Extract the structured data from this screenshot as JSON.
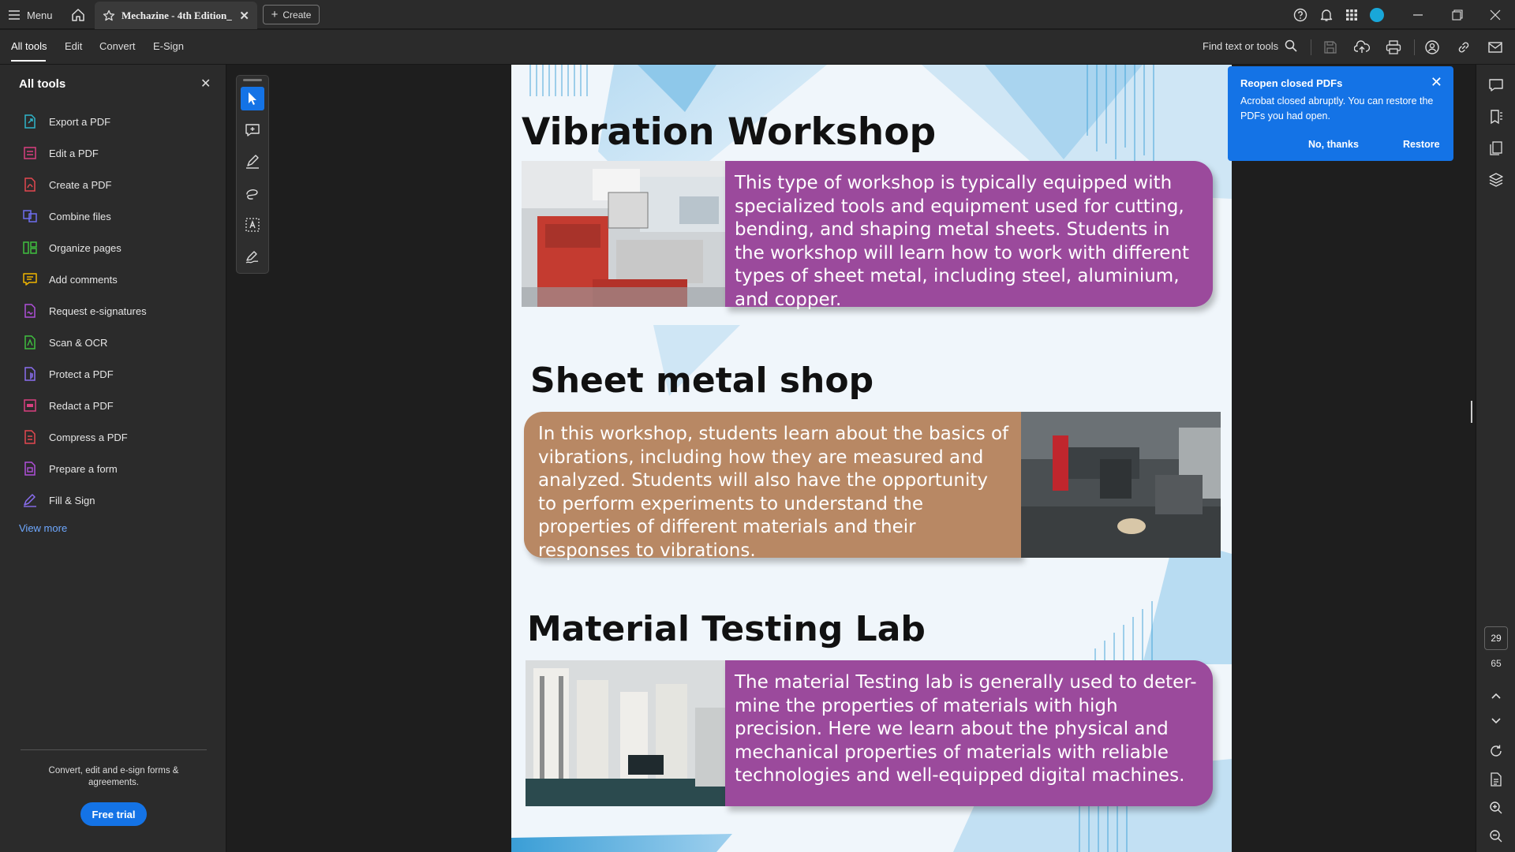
{
  "titlebar": {
    "menu_label": "Menu",
    "tab_title": "Mechazine - 4th Edition_",
    "create_label": "Create"
  },
  "toolbar": {
    "tabs": [
      "All tools",
      "Edit",
      "Convert",
      "E-Sign"
    ],
    "find_label": "Find text or tools"
  },
  "left_panel": {
    "title": "All tools",
    "items": [
      {
        "label": "Export a PDF",
        "icon": "export-pdf-icon",
        "color": "#2fb5c9"
      },
      {
        "label": "Edit a PDF",
        "icon": "edit-pdf-icon",
        "color": "#d9407f"
      },
      {
        "label": "Create a PDF",
        "icon": "create-pdf-icon",
        "color": "#e34850"
      },
      {
        "label": "Combine files",
        "icon": "combine-files-icon",
        "color": "#6e6ef0"
      },
      {
        "label": "Organize pages",
        "icon": "organize-pages-icon",
        "color": "#3fbf3f"
      },
      {
        "label": "Add comments",
        "icon": "add-comments-icon",
        "color": "#f0b400"
      },
      {
        "label": "Request e-signatures",
        "icon": "request-esign-icon",
        "color": "#b04fd9"
      },
      {
        "label": "Scan & OCR",
        "icon": "scan-ocr-icon",
        "color": "#3fbf3f"
      },
      {
        "label": "Protect a PDF",
        "icon": "protect-pdf-icon",
        "color": "#8a6ef0"
      },
      {
        "label": "Redact a PDF",
        "icon": "redact-pdf-icon",
        "color": "#d9407f"
      },
      {
        "label": "Compress a PDF",
        "icon": "compress-pdf-icon",
        "color": "#e34850"
      },
      {
        "label": "Prepare a form",
        "icon": "prepare-form-icon",
        "color": "#b04fd9"
      },
      {
        "label": "Fill & Sign",
        "icon": "fill-sign-icon",
        "color": "#8a6ef0"
      }
    ],
    "view_more": "View more",
    "promo": "Convert, edit and e-sign forms & agreements.",
    "free_trial": "Free trial"
  },
  "notification": {
    "title": "Reopen closed PDFs",
    "body": "Acrobat closed abruptly. You can restore the PDFs you had open.",
    "no_thanks": "No, thanks",
    "restore": "Restore"
  },
  "document": {
    "sections": [
      {
        "heading": "Vibration Workshop",
        "text": "This type of workshop is typically equipped with specialized tools and equipment used for cutting, bending, and shaping metal sheets. Students in the workshop will learn how to work with different types of sheet metal, including steel, aluminium, and copper.",
        "card_color": "#9b4a9c"
      },
      {
        "heading": "Sheet metal shop",
        "text": "In this workshop, students learn about the basics of vibrations, including how they are measured and analyzed. Students will also have the opportunity to perform experiments to understand the properties of different materials and their responses to vibrations.",
        "card_color": "#b88864"
      },
      {
        "heading": "Material Testing Lab",
        "text": "The material Testing lab is generally used to deter-mine the properties of materials with high precision. Here we learn about the physical and mechanical properties of materials with reliable technologies and well-equipped digital machines.",
        "card_color": "#9b4a9c"
      }
    ]
  },
  "page_nav": {
    "current": "29",
    "total": "65"
  },
  "colors": {
    "accent": "#1473e6",
    "app_bg": "#1e1e1e",
    "panel_bg": "#2b2b2b"
  }
}
